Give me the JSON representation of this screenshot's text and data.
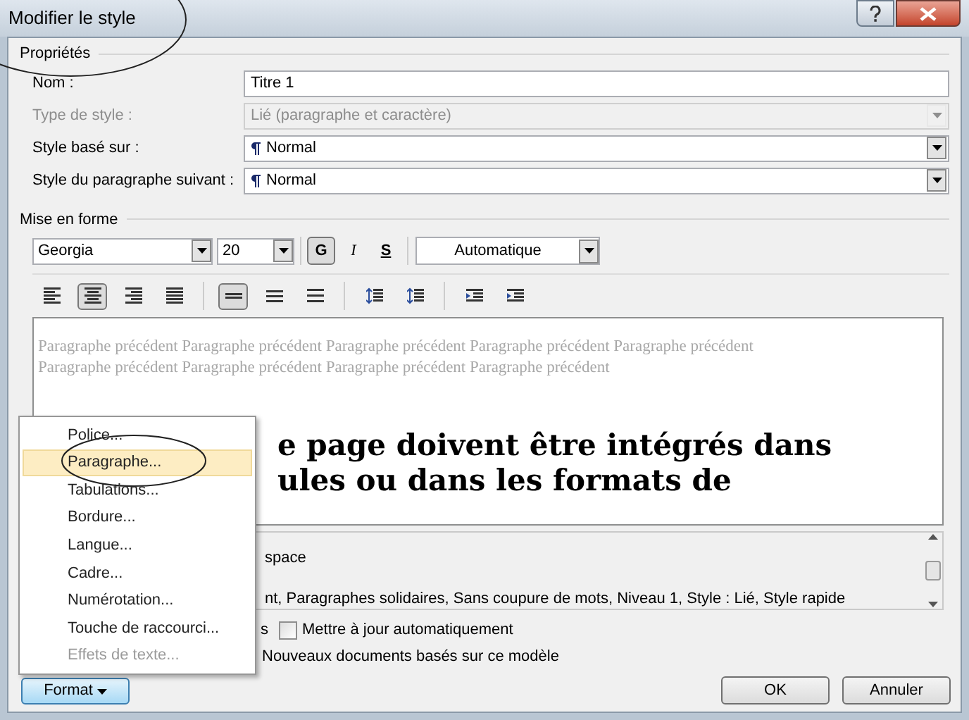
{
  "window": {
    "title": "Modifier le style"
  },
  "properties": {
    "title": "Propriétés",
    "fields": [
      {
        "label": "Nom :",
        "value": "Titre 1",
        "kind": "text",
        "disabled": false
      },
      {
        "label": "Type de style :",
        "value": "Lié (paragraphe et caractère)",
        "kind": "combo",
        "disabled": true
      },
      {
        "label": "Style basé sur :",
        "value": "Normal",
        "kind": "stylecombo",
        "disabled": false
      },
      {
        "label": "Style du paragraphe suivant :",
        "value": "Normal",
        "kind": "stylecombo",
        "disabled": false
      }
    ]
  },
  "formatting": {
    "title": "Mise en forme",
    "font": "Georgia",
    "size": "20",
    "styles": [
      {
        "label": "G",
        "selected": true
      },
      {
        "label": "I",
        "selected": false
      },
      {
        "label": "S",
        "selected": false
      }
    ],
    "color_choice": "Automatique",
    "tools": [
      {
        "kind": "align-left",
        "selected": false
      },
      {
        "kind": "align-center",
        "selected": true
      },
      {
        "kind": "align-right",
        "selected": false
      },
      {
        "kind": "justify",
        "selected": false
      },
      {
        "kind": "sep"
      },
      {
        "kind": "single",
        "selected": true
      },
      {
        "kind": "onehalf",
        "selected": false
      },
      {
        "kind": "double",
        "selected": false
      },
      {
        "kind": "sep"
      },
      {
        "kind": "space-before",
        "selected": false
      },
      {
        "kind": "space-after",
        "selected": false
      },
      {
        "kind": "sep"
      },
      {
        "kind": "indent-less",
        "selected": false
      },
      {
        "kind": "indent-more",
        "selected": false
      }
    ]
  },
  "preview": {
    "previous": "Paragraphe précédent Paragraphe précédent Paragraphe précédent Paragraphe précédent Paragraphe précédent Paragraphe précédent Paragraphe précédent Paragraphe précédent Paragraphe précédent",
    "sample": [
      "e page doivent être intégrés dans",
      "ules ou dans les formats de"
    ]
  },
  "description": [
    "space",
    "nt, Paragraphes solidaires, Sans coupure de mots, Niveau 1, Style : Lié, Style rapide"
  ],
  "options": {
    "gallery_tail": "s",
    "auto_update": {
      "label": "Mettre à jour automatiquement",
      "checked": false
    },
    "new_docs": {
      "label": "Nouveaux documents basés sur ce modèle"
    }
  },
  "format_menu": [
    {
      "label": "Police...",
      "selected": false,
      "disabled": false
    },
    {
      "label": "Paragraphe...",
      "selected": true,
      "disabled": false
    },
    {
      "label": "Tabulations...",
      "selected": false,
      "disabled": false
    },
    {
      "label": "Bordure...",
      "selected": false,
      "disabled": false
    },
    {
      "label": "Langue...",
      "selected": false,
      "disabled": false
    },
    {
      "label": "Cadre...",
      "selected": false,
      "disabled": false
    },
    {
      "label": "Numérotation...",
      "selected": false,
      "disabled": false
    },
    {
      "label": "Touche de raccourci...",
      "selected": false,
      "disabled": false
    },
    {
      "label": "Effets de texte...",
      "selected": false,
      "disabled": true
    }
  ],
  "format_button": "Format",
  "buttons": [
    "OK",
    "Annuler"
  ]
}
